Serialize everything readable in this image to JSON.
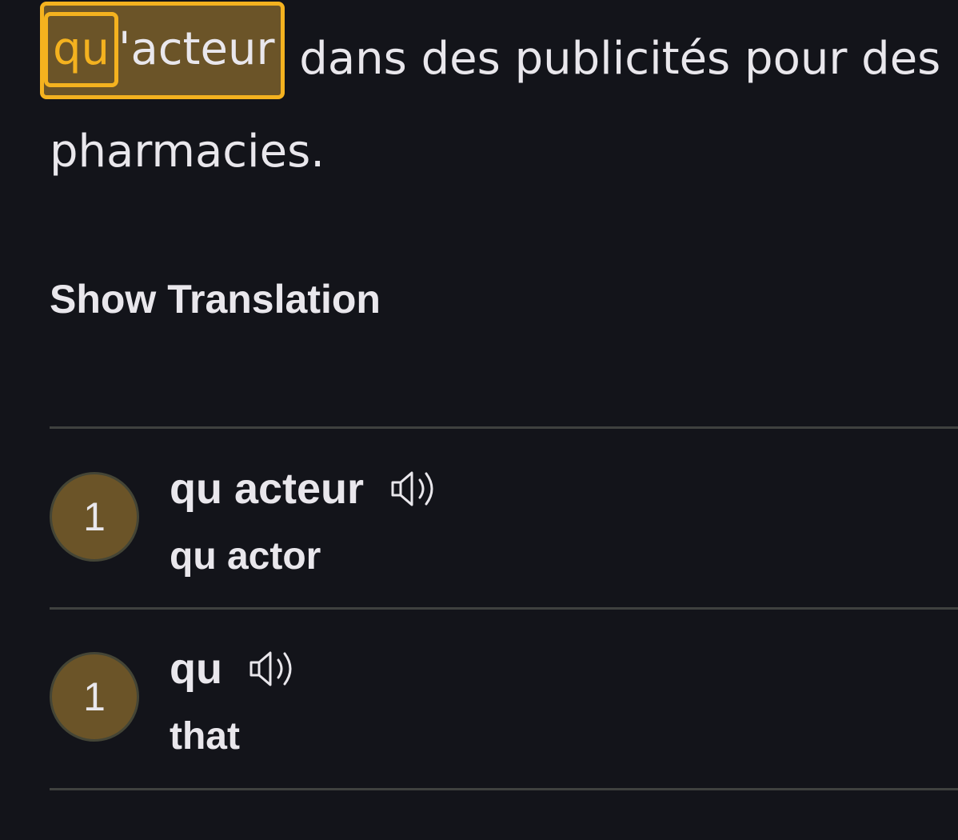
{
  "sentence": {
    "highlight_prefix": "qu",
    "apostrophe": "'",
    "highlight_rest": "acteur",
    "line1_after": " dans des publicités pour des",
    "line2": "pharmacies."
  },
  "show_translation_label": "Show Translation",
  "entries": [
    {
      "count": "1",
      "term": "qu acteur",
      "gloss": "qu actor",
      "audio_icon": "speaker-icon"
    },
    {
      "count": "1",
      "term": "qu",
      "gloss": "that",
      "audio_icon": "speaker-icon"
    }
  ],
  "colors": {
    "background": "#13141a",
    "text": "#e9e7ec",
    "highlight_fill": "#6b5428",
    "highlight_border": "#f4b21f",
    "divider": "#3f413f"
  }
}
